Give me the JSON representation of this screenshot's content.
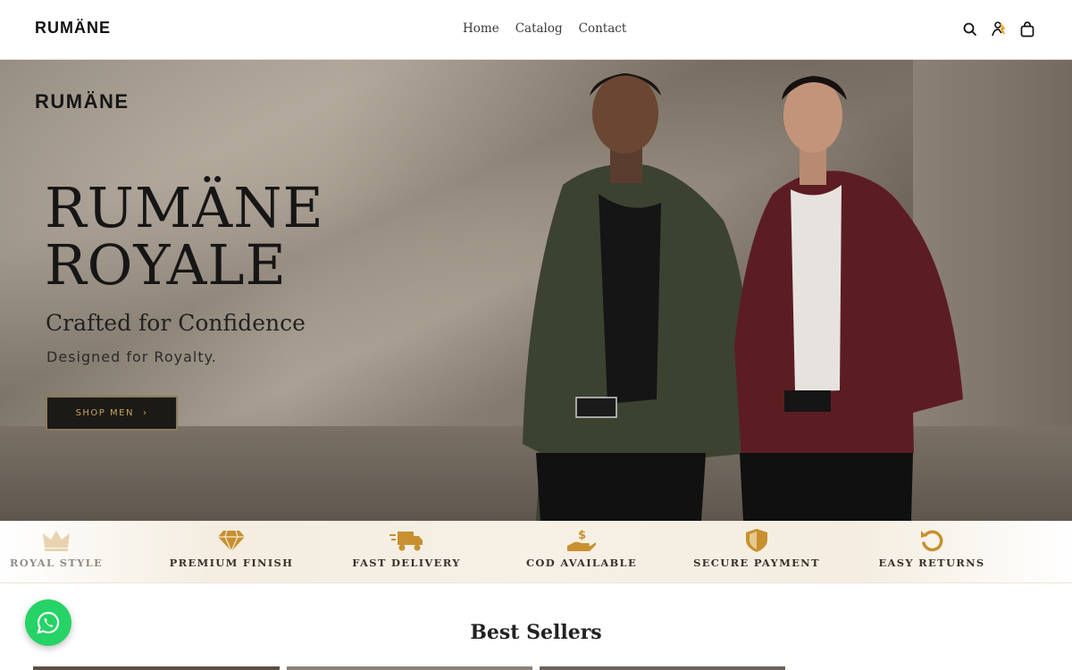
{
  "header": {
    "logo": "RUMÄNE",
    "nav": [
      "Home",
      "Catalog",
      "Contact"
    ],
    "icons": [
      "search-icon",
      "account-icon",
      "cart-icon"
    ]
  },
  "hero": {
    "brand": "RUMÄNE",
    "title_line1": "RUMÄNE",
    "title_line2": "ROYALE",
    "subtitle": "Crafted for Confidence",
    "tagline": "Designed for Royalty.",
    "cta_label": "SHOP MEN",
    "cta_arrow": "›"
  },
  "features": [
    {
      "label": "ROYAL STYLE",
      "icon": "crown-icon"
    },
    {
      "label": "PREMIUM FINISH",
      "icon": "diamond-icon"
    },
    {
      "label": "FAST DELIVERY",
      "icon": "truck-icon"
    },
    {
      "label": "COD AVAILABLE",
      "icon": "cash-hand-icon"
    },
    {
      "label": "SECURE PAYMENT",
      "icon": "shield-icon"
    },
    {
      "label": "EASY RETURNS",
      "icon": "return-icon"
    }
  ],
  "best_sellers": {
    "title": "Best Sellers"
  },
  "colors": {
    "accent_gold": "#c8902f",
    "dark": "#1c1a17",
    "whatsapp": "#25d366"
  }
}
